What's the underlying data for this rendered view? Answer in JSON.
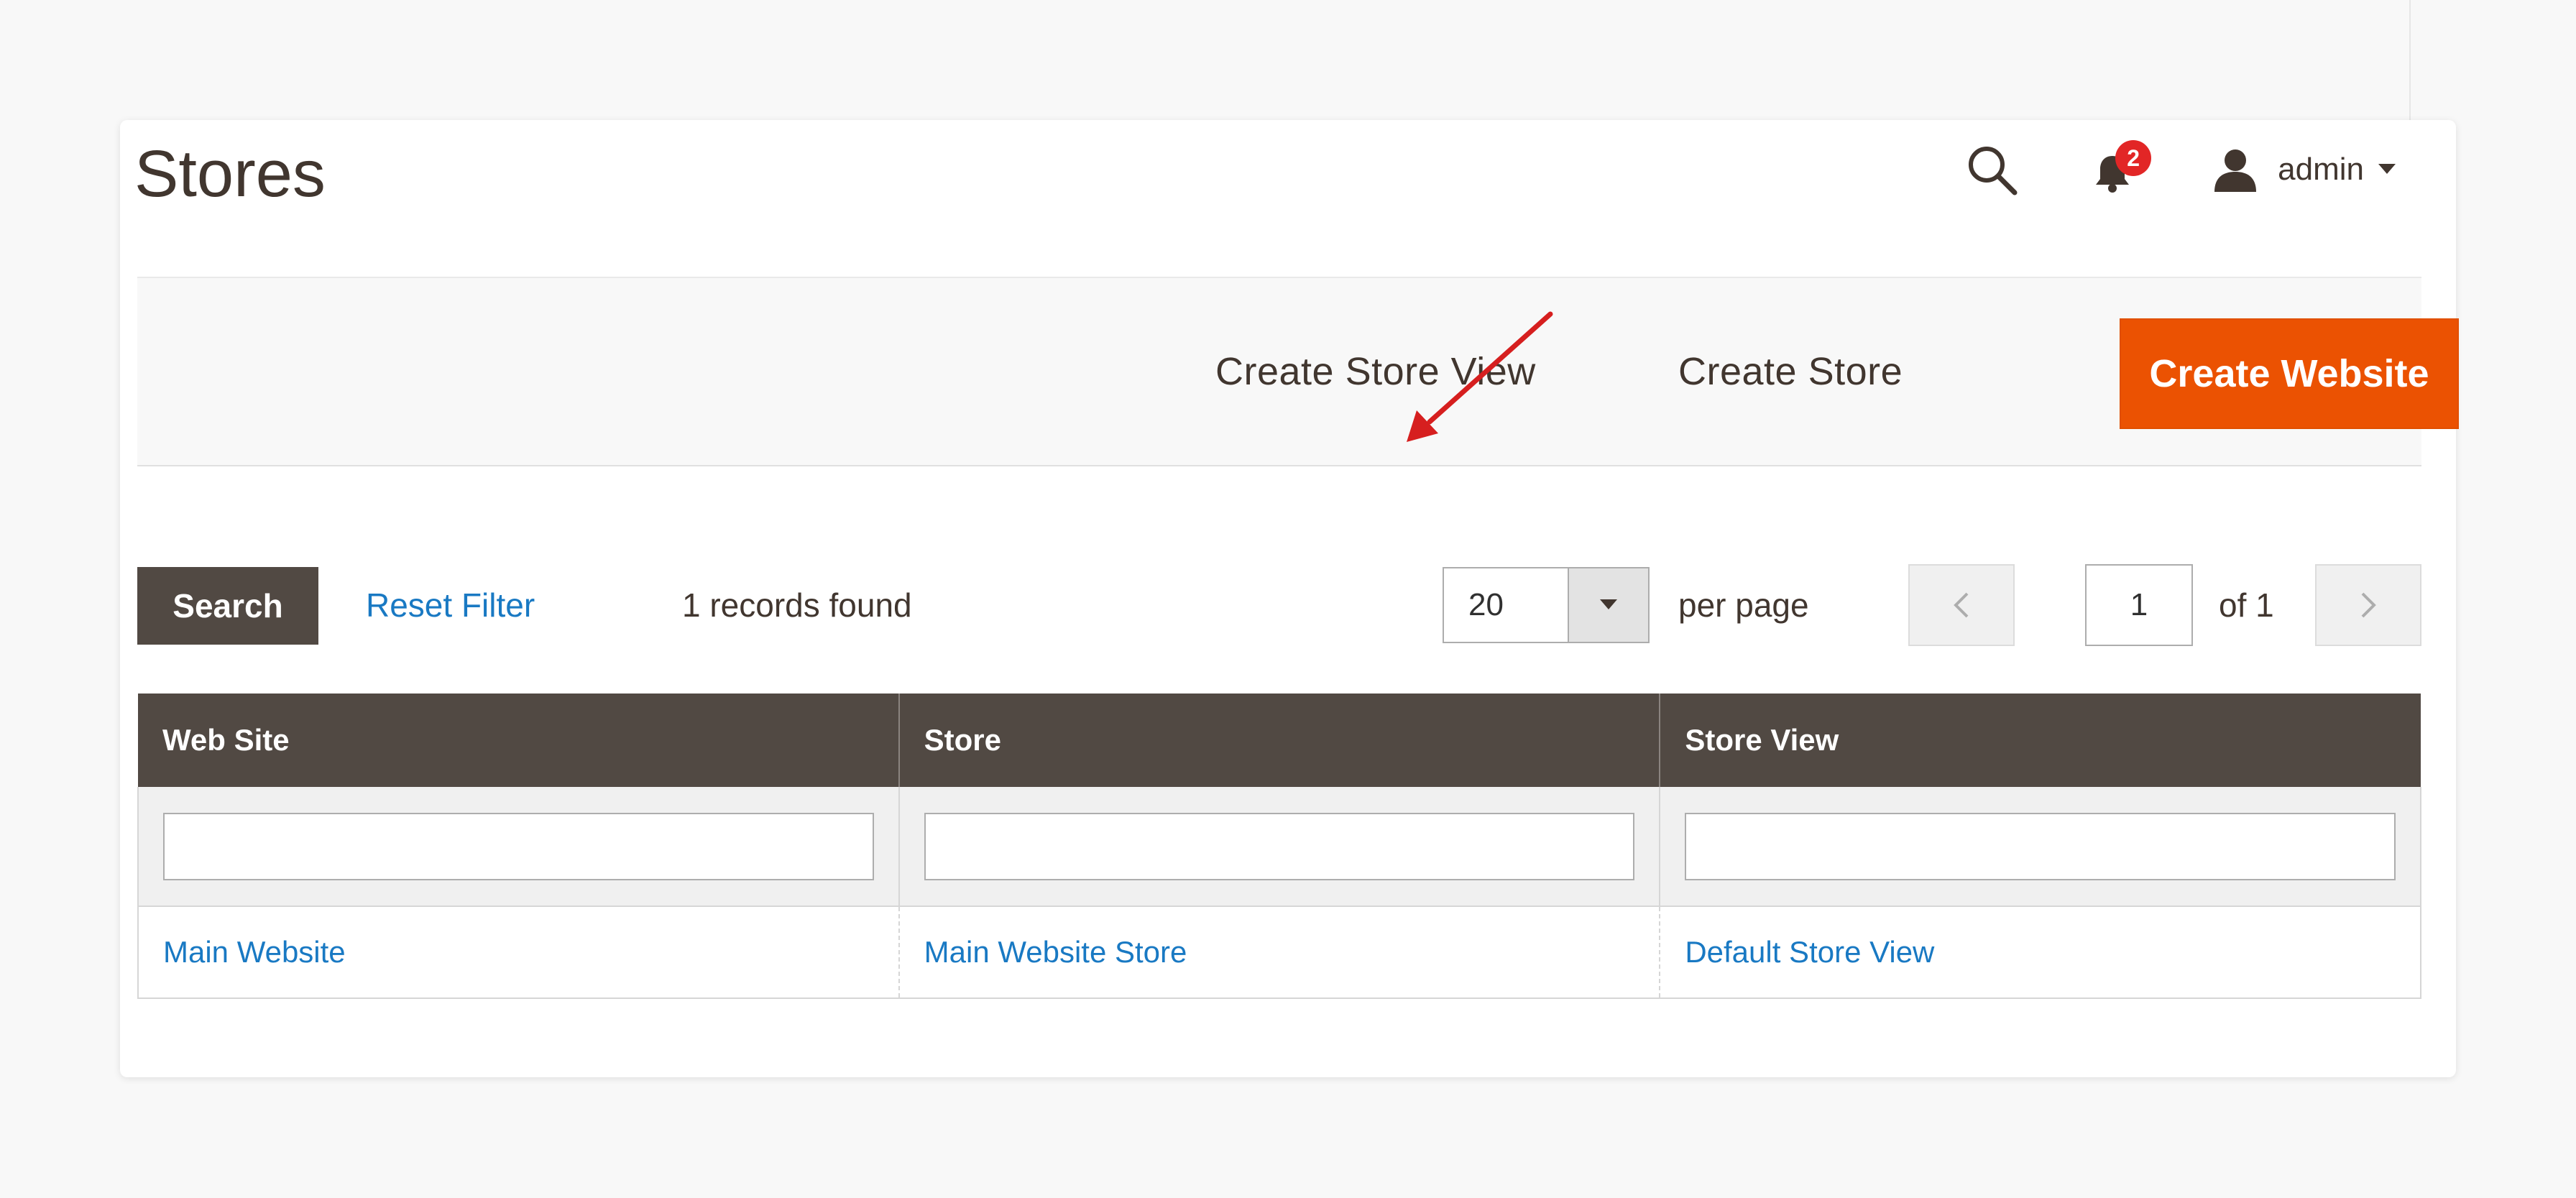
{
  "page": {
    "title": "Stores"
  },
  "header": {
    "notification_count": "2",
    "user_name": "admin"
  },
  "actions": {
    "create_store_view": "Create Store View",
    "create_store": "Create Store",
    "create_website": "Create Website"
  },
  "toolbar": {
    "search_label": "Search",
    "reset_filter_label": "Reset Filter",
    "records_found": "1 records found",
    "page_size": "20",
    "per_page_label": "per page",
    "current_page": "1",
    "page_of": "of 1"
  },
  "grid": {
    "columns": [
      "Web Site",
      "Store",
      "Store View"
    ],
    "rows": [
      [
        "Main Website",
        "Main Website Store",
        "Default Store View"
      ]
    ]
  },
  "colors": {
    "accent": "#eb5202",
    "header_bg": "#514943",
    "link": "#1979c3",
    "annotation_arrow": "#d61f1f",
    "badge": "#e22626"
  }
}
